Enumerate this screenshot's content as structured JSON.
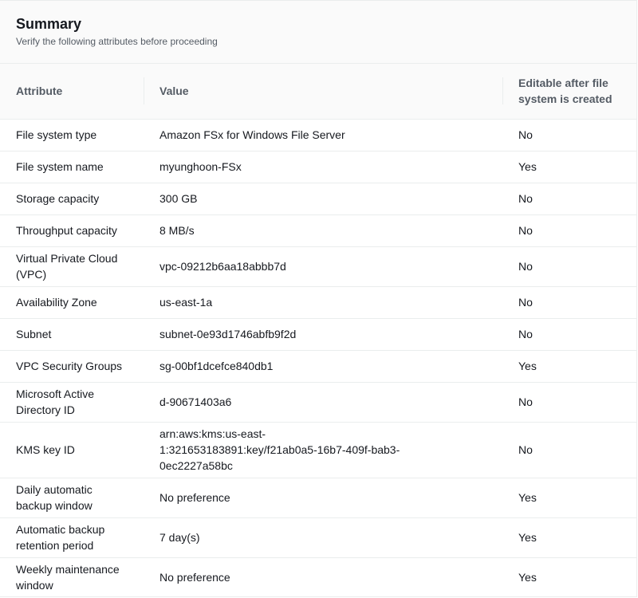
{
  "summary": {
    "title": "Summary",
    "subtitle": "Verify the following attributes before proceeding"
  },
  "table": {
    "columns": {
      "attribute": "Attribute",
      "value": "Value",
      "editable": "Editable after file system is created"
    },
    "rows": [
      {
        "attribute": "File system type",
        "value": "Amazon FSx for Windows File Server",
        "editable": "No"
      },
      {
        "attribute": "File system name",
        "value": "myunghoon-FSx",
        "editable": "Yes"
      },
      {
        "attribute": "Storage capacity",
        "value": "300 GB",
        "editable": "No"
      },
      {
        "attribute": "Throughput capacity",
        "value": "8 MB/s",
        "editable": "No"
      },
      {
        "attribute": "Virtual Private Cloud (VPC)",
        "value": "vpc-09212b6aa18abbb7d",
        "editable": "No"
      },
      {
        "attribute": "Availability Zone",
        "value": "us-east-1a",
        "editable": "No"
      },
      {
        "attribute": "Subnet",
        "value": "subnet-0e93d1746abfb9f2d",
        "editable": "No"
      },
      {
        "attribute": "VPC Security Groups",
        "value": "sg-00bf1dcefce840db1",
        "editable": "Yes"
      },
      {
        "attribute": "Microsoft Active Directory ID",
        "value": "d-90671403a6",
        "editable": "No"
      },
      {
        "attribute": "KMS key ID",
        "value": "arn:aws:kms:us-east-1:321653183891:key/f21ab0a5-16b7-409f-bab3-0ec2227a58bc",
        "editable": "No"
      },
      {
        "attribute": "Daily automatic backup window",
        "value": "No preference",
        "editable": "Yes"
      },
      {
        "attribute": "Automatic backup retention period",
        "value": "7 day(s)",
        "editable": "Yes"
      },
      {
        "attribute": "Weekly maintenance window",
        "value": "No preference",
        "editable": "Yes"
      }
    ]
  }
}
